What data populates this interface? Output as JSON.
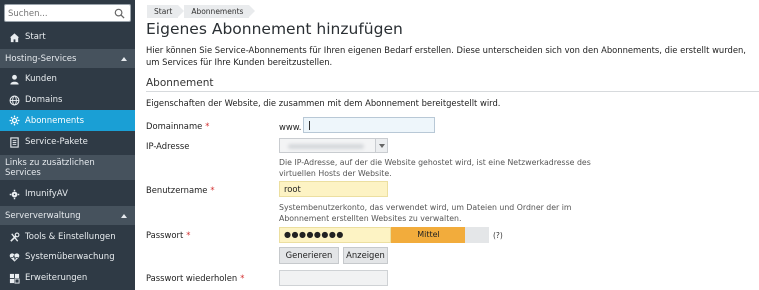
{
  "sidebar": {
    "search": {
      "placeholder": "Suchen..."
    },
    "start": "Start",
    "sections": {
      "hosting": "Hosting-Services",
      "links": "Links zu zusätzlichen Services",
      "server": "Serververwaltung"
    },
    "hosting_items": [
      "Kunden",
      "Domains",
      "Abonnements",
      "Service-Pakete"
    ],
    "links_items": [
      "ImunifyAV"
    ],
    "server_items": [
      "Tools & Einstellungen",
      "Systemüberwachung",
      "Erweiterungen"
    ],
    "active_item": "Abonnements",
    "accent_color": "#1a9fd5"
  },
  "breadcrumb": [
    "Start",
    "Abonnements"
  ],
  "page_title": "Eigenes Abonnement hinzufügen",
  "intro": "Hier können Sie Service-Abonnements für Ihren eigenen Bedarf erstellen. Diese unterscheiden sich von den Abonnements, die erstellt wurden, um Services für Ihre Kunden bereitzustellen.",
  "section_title": "Abonnement",
  "section_desc": "Eigenschaften der Website, die zusammen mit dem Abonnement bereitgestellt wird.",
  "form": {
    "domain": {
      "label": "Domainname",
      "required": "*",
      "prefix": "www.",
      "value": ""
    },
    "ip": {
      "label": "IP-Adresse",
      "hint": "Die IP-Adresse, auf der die Website gehostet wird, ist eine Netzwerkadresse des virtuellen Hosts der Website."
    },
    "username": {
      "label": "Benutzername",
      "required": "*",
      "value": "root",
      "hint": "Systembenutzerkonto, das verwendet wird, um Dateien und Ordner der im Abonnement erstellten Websites zu verwalten."
    },
    "password": {
      "label": "Passwort",
      "required": "*",
      "value": "●●●●●●●●",
      "strength": "Mittel",
      "strength_level": 0.76,
      "strength_color": "#f2ac3c",
      "help": "(?)"
    },
    "buttons": {
      "generate": "Generieren",
      "show": "Anzeigen"
    },
    "password_repeat": {
      "label": "Passwort wiederholen",
      "required": "*",
      "value": ""
    }
  }
}
